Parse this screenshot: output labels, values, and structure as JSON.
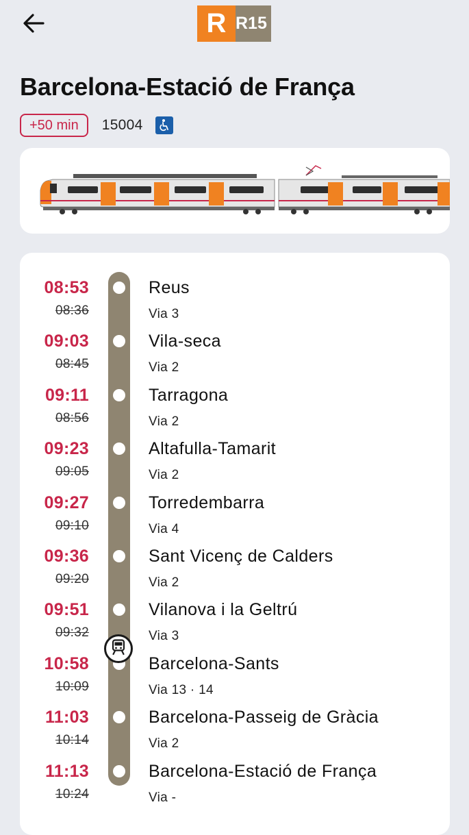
{
  "header": {
    "back_icon": "arrow-left-icon",
    "logo": {
      "letter": "R",
      "line": "R15",
      "letter_color": "#f08221",
      "line_color": "#8f8571"
    }
  },
  "title": "Barcelona-Estació de França",
  "meta": {
    "delay": "+50 min",
    "train_number": "15004",
    "accessibility_icon": "wheelchair-icon"
  },
  "colors": {
    "delay": "#c8264a",
    "rail": "#8f8571",
    "background": "#e9ebf0",
    "card": "#ffffff"
  },
  "stops": [
    {
      "actual": "08:53",
      "scheduled": "08:36",
      "name": "Reus",
      "platform": "Via 3"
    },
    {
      "actual": "09:03",
      "scheduled": "08:45",
      "name": "Vila-seca",
      "platform": "Via 2"
    },
    {
      "actual": "09:11",
      "scheduled": "08:56",
      "name": "Tarragona",
      "platform": "Via 2"
    },
    {
      "actual": "09:23",
      "scheduled": "09:05",
      "name": "Altafulla-Tamarit",
      "platform": "Via 2"
    },
    {
      "actual": "09:27",
      "scheduled": "09:10",
      "name": "Torredembarra",
      "platform": "Via 4"
    },
    {
      "actual": "09:36",
      "scheduled": "09:20",
      "name": "Sant Vicenç de Calders",
      "platform": "Via 2"
    },
    {
      "actual": "09:51",
      "scheduled": "09:32",
      "name": "Vilanova i la Geltrú",
      "platform": "Via 3"
    },
    {
      "actual": "10:58",
      "scheduled": "10:09",
      "name": "Barcelona-Sants",
      "platform": "Via 13 · 14"
    },
    {
      "actual": "11:03",
      "scheduled": "10:14",
      "name": "Barcelona-Passeig de Gràcia",
      "platform": "Via 2"
    },
    {
      "actual": "11:13",
      "scheduled": "10:24",
      "name": "Barcelona-Estació de França",
      "platform": "Via -"
    }
  ],
  "train_marker_icon": "train-icon"
}
